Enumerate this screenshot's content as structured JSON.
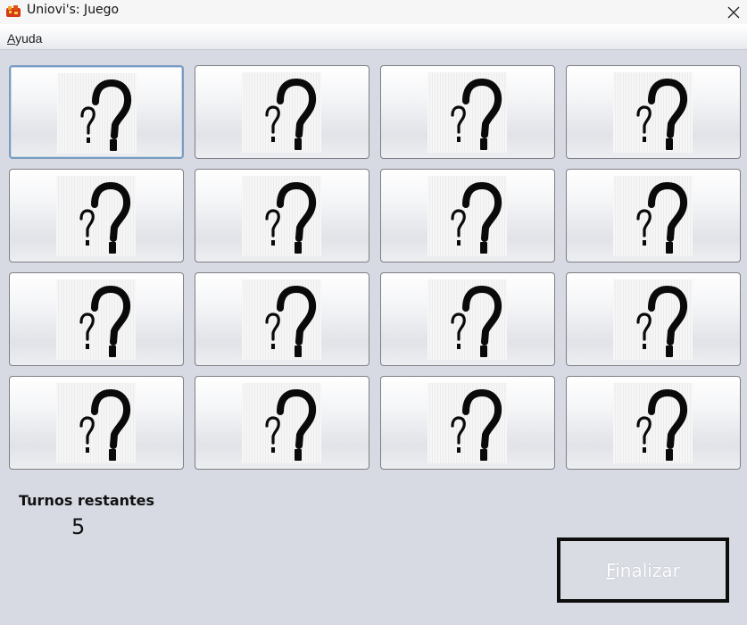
{
  "window": {
    "title": "Uniovi's: Juego",
    "close_icon": "close-icon",
    "app_icon": "app-icon"
  },
  "menu": {
    "items": [
      {
        "mnemonic": "A",
        "rest": "yuda"
      }
    ]
  },
  "board": {
    "rows": 4,
    "columns": 4,
    "card_icon": "question-mark-icon",
    "focused_card": 0
  },
  "status": {
    "turns_label": "Turnos restantes",
    "turns_value": "5"
  },
  "actions": {
    "finish_mnemonic": "F",
    "finish_rest": "inalizar"
  },
  "colors": {
    "background": "#d7dae2",
    "focus_border": "#7a9cbf"
  }
}
